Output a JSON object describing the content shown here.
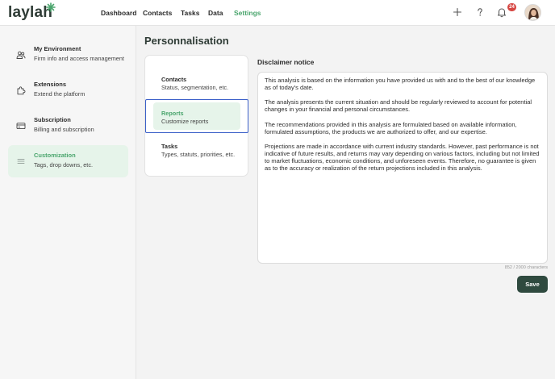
{
  "app": {
    "logo": "laylah"
  },
  "nav": {
    "items": [
      {
        "label": "Dashboard"
      },
      {
        "label": "Contacts"
      },
      {
        "label": "Tasks"
      },
      {
        "label": "Data"
      },
      {
        "label": "Settings"
      }
    ],
    "active": "Settings",
    "notification_count": "24"
  },
  "sidebar": {
    "items": [
      {
        "title": "My Environment",
        "subtitle": "Firm info and access management",
        "icon": "users-icon"
      },
      {
        "title": "Extensions",
        "subtitle": "Extend the platform",
        "icon": "puzzle-icon"
      },
      {
        "title": "Subscription",
        "subtitle": "Billing and subscription",
        "icon": "credit-card-icon"
      },
      {
        "title": "Customization",
        "subtitle": "Tags, drop downs, etc.",
        "icon": "lines-icon"
      }
    ],
    "active": "Customization"
  },
  "main": {
    "title": "Personnalisation",
    "categories": [
      {
        "title": "Contacts",
        "subtitle": "Status, segmentation, etc."
      },
      {
        "title": "Reports",
        "subtitle": "Customize reports"
      },
      {
        "title": "Tasks",
        "subtitle": "Types, statuts, priorities, etc."
      }
    ],
    "active_category": "Reports",
    "disclaimer": {
      "label": "Disclaimer notice",
      "text": "This analysis is based on the information you have provided us with and to the best of our knowledge as of today's date.\n\nThe analysis presents the current situation and should be regularly reviewed to account for potential changes in your financial and personal circumstances.\n\nThe recommendations provided in this analysis are formulated based on available information, formulated assumptions, the products we are authorized to offer, and our expertise.\n\nProjections are made in accordance with current industry standards. However, past performance is not indicative of future results, and returns may vary depending on various factors, including but not limited to market fluctuations, economic conditions, and unforeseen events. Therefore, no guarantee is given as to the accuracy or realization of the return projections included in this analysis.",
      "counter": "852 / 2000 characters"
    },
    "save_label": "Save"
  },
  "colors": {
    "accent": "#4aa56d",
    "active_bg": "#e6f4ea",
    "primary_button": "#2f4a3f",
    "badge": "#d64541",
    "focus_border": "#3a5fc8"
  }
}
